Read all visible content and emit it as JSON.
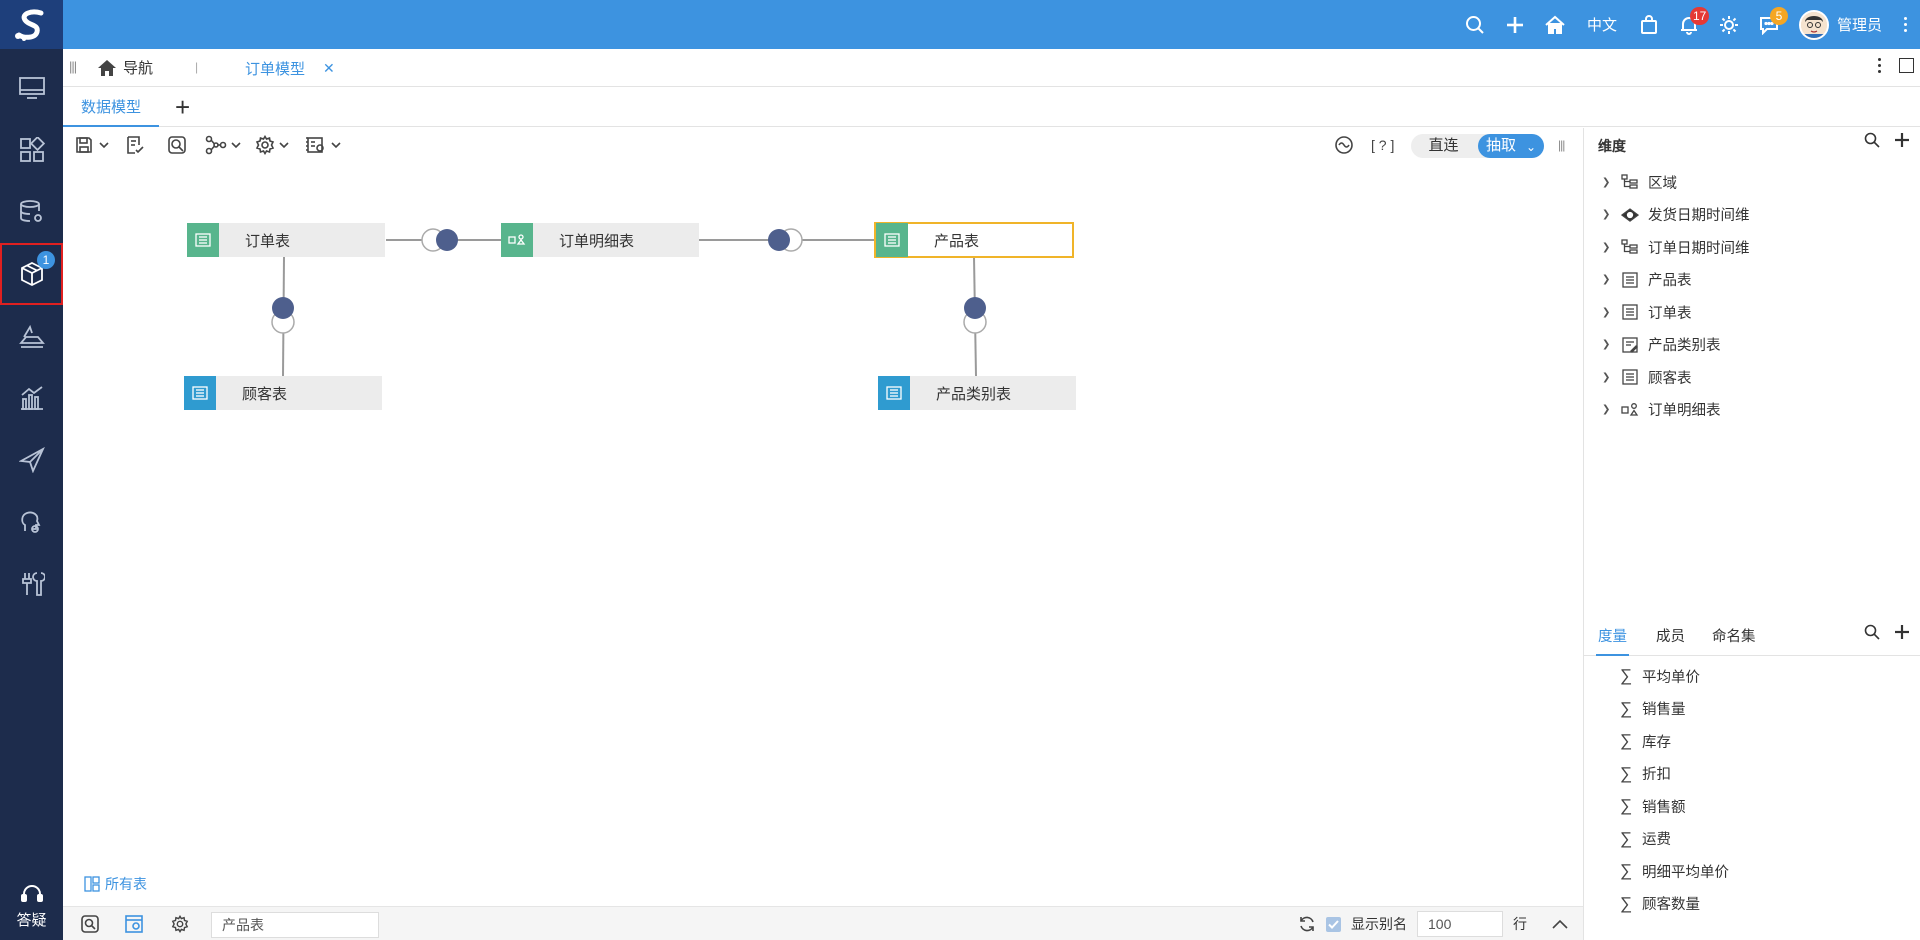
{
  "topbar": {
    "lang": "中文",
    "notifications_count": "17",
    "messages_count": "5",
    "username": "管理员"
  },
  "sidebar": {
    "models_badge": "1",
    "help_label": "答疑"
  },
  "navbar": {
    "home_label": "导航",
    "active_tab": "订单模型"
  },
  "subtabs": {
    "active": "数据模型"
  },
  "toolbar": {
    "mode_direct": "直连",
    "mode_extract": "抽取",
    "help_text": "[ ? ]"
  },
  "canvas": {
    "tables": {
      "orders": "订单表",
      "order_details": "订单明细表",
      "products": "产品表",
      "customers": "顾客表",
      "product_categories": "产品类别表"
    },
    "all_tables_label": "所有表"
  },
  "bottombar": {
    "search_value": "产品表",
    "show_alias_label": "显示别名",
    "rows_value": "100",
    "rows_unit": "行"
  },
  "right_panel": {
    "dimension_title": "维度",
    "dimensions": [
      {
        "label": "区域",
        "icon": "hierarchy-icon"
      },
      {
        "label": "发货日期时间维",
        "icon": "date-dimension-icon"
      },
      {
        "label": "订单日期时间维",
        "icon": "hierarchy-icon"
      },
      {
        "label": "产品表",
        "icon": "table-icon"
      },
      {
        "label": "订单表",
        "icon": "table-icon"
      },
      {
        "label": "产品类别表",
        "icon": "table-edit-icon"
      },
      {
        "label": "顾客表",
        "icon": "table-icon"
      },
      {
        "label": "订单明细表",
        "icon": "fact-table-icon"
      }
    ],
    "measure_tabs": [
      "度量",
      "成员",
      "命名集"
    ],
    "measures": [
      "平均单价",
      "销售量",
      "库存",
      "折扣",
      "销售额",
      "运费",
      "明细平均单价",
      "顾客数量"
    ]
  },
  "colors": {
    "accent": "#3d93e0",
    "sidebar": "#1d2c4c",
    "logo_bg": "#1e3f7b",
    "node_green": "#58b58d",
    "node_blue": "#2f9bd0",
    "join_dot": "#4e5f8d",
    "selected_border": "#f0b429"
  }
}
